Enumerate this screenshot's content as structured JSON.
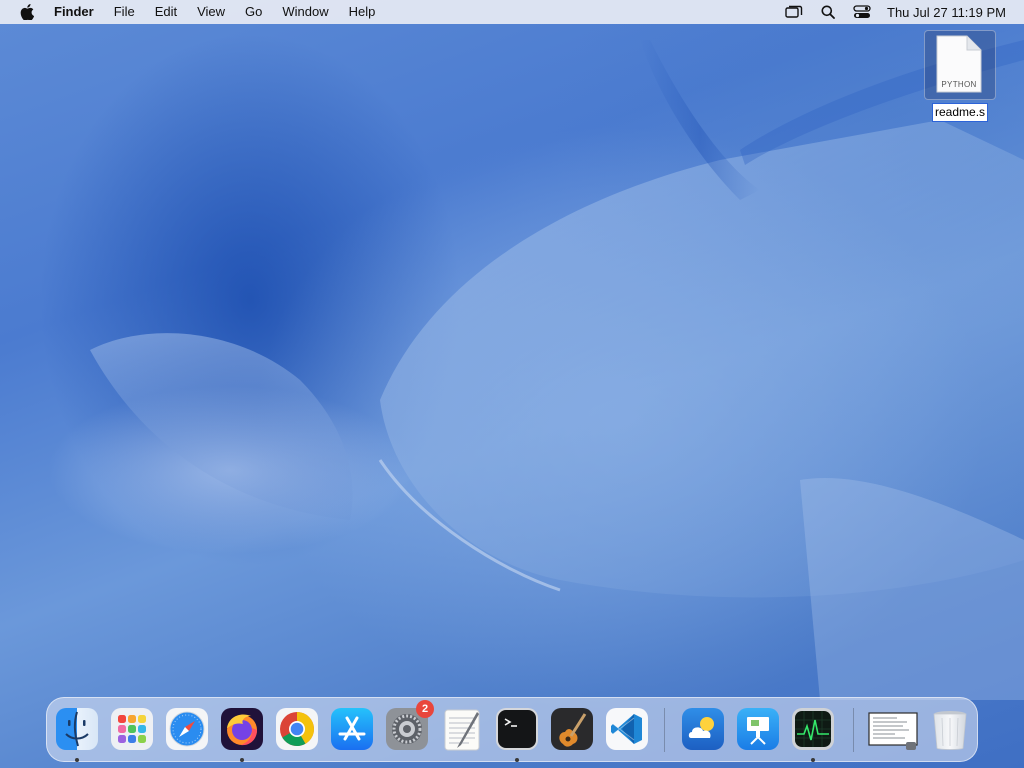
{
  "menubar": {
    "apple_icon": "apple-logo-icon",
    "app_name": "Finder",
    "menus": [
      "File",
      "Edit",
      "View",
      "Go",
      "Window",
      "Help"
    ],
    "status_icons": [
      "screen-mirroring-icon",
      "spotlight-search-icon",
      "control-center-icon"
    ],
    "clock": "Thu Jul 27  11:19 PM"
  },
  "desktop_file": {
    "type_label": "PYTHON",
    "filename": "readme.s"
  },
  "dock": {
    "apps": [
      {
        "name": "finder",
        "icon": "finder-icon",
        "running": true
      },
      {
        "name": "launchpad",
        "icon": "launchpad-icon",
        "running": false
      },
      {
        "name": "safari",
        "icon": "safari-icon",
        "running": false
      },
      {
        "name": "firefox",
        "icon": "firefox-icon",
        "running": true
      },
      {
        "name": "chrome",
        "icon": "chrome-icon",
        "running": false
      },
      {
        "name": "app-store",
        "icon": "app-store-icon",
        "running": false
      },
      {
        "name": "system-settings",
        "icon": "system-settings-icon",
        "running": false,
        "badge": "2"
      },
      {
        "name": "textedit",
        "icon": "textedit-icon",
        "running": false
      },
      {
        "name": "terminal",
        "icon": "terminal-icon",
        "running": true
      },
      {
        "name": "garageband",
        "icon": "garageband-icon",
        "running": false
      },
      {
        "name": "vscode",
        "icon": "vscode-icon",
        "running": false
      },
      {
        "name": "weather",
        "icon": "weather-icon",
        "running": false
      },
      {
        "name": "keynote",
        "icon": "keynote-icon",
        "running": false
      },
      {
        "name": "activity-monitor",
        "icon": "activity-monitor-icon",
        "running": true
      },
      {
        "name": "minimized-window",
        "icon": "minimized-window-icon",
        "running": false
      },
      {
        "name": "trash",
        "icon": "trash-icon",
        "running": false
      }
    ],
    "colors": {
      "badge": "#e9463c",
      "selection": "#2c63d8"
    }
  }
}
